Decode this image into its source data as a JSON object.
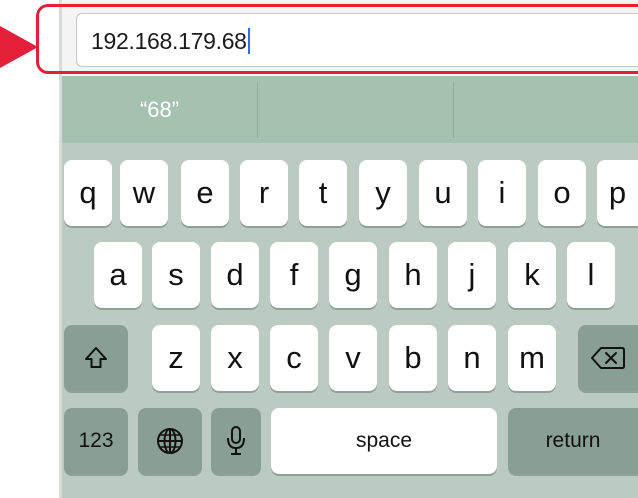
{
  "address_bar": {
    "value": "192.168.179.68"
  },
  "suggestion": {
    "text": "“68”"
  },
  "keyboard": {
    "row1": [
      "q",
      "w",
      "e",
      "r",
      "t",
      "y",
      "u",
      "i",
      "o",
      "p"
    ],
    "row2": [
      "a",
      "s",
      "d",
      "f",
      "g",
      "h",
      "j",
      "k",
      "l"
    ],
    "row3": [
      "z",
      "x",
      "c",
      "v",
      "b",
      "n",
      "m"
    ],
    "numbers_label": "123",
    "space_label": "space",
    "return_label": "return"
  },
  "icons": {
    "pointer": "red-triangle-arrow-icon",
    "shift": "shift-icon",
    "delete": "delete-backspace-icon",
    "globe": "globe-icon",
    "mic": "microphone-icon"
  },
  "colors": {
    "highlight": "#e31f3a",
    "keyboard_bg": "#bccbc2",
    "suggestion_bar": "#a5c2b1",
    "caret": "#2f6fe0"
  }
}
